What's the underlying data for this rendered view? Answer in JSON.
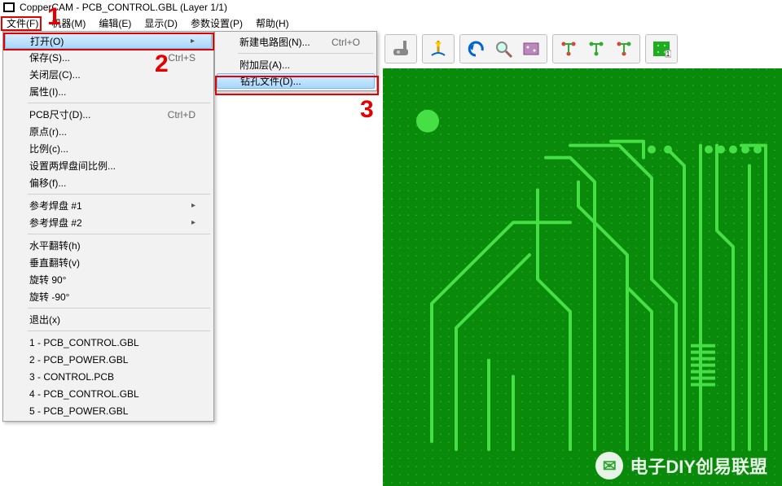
{
  "title": "CopperCAM  -  PCB_CONTROL.GBL   (Layer 1/1)",
  "menubar": [
    "文件(F)",
    "机器(M)",
    "编辑(E)",
    "显示(D)",
    "参数设置(P)",
    "帮助(H)"
  ],
  "annotations": {
    "n1": "1",
    "n2": "2",
    "n3": "3"
  },
  "file_menu": [
    {
      "k": "open",
      "label": "打开(O)",
      "arrow": true,
      "hi": true
    },
    {
      "k": "save",
      "label": "保存(S)...",
      "sc": "Ctrl+S"
    },
    {
      "k": "close",
      "label": "关闭层(C)..."
    },
    {
      "k": "attr",
      "label": "属性(I)..."
    },
    {
      "sep": true
    },
    {
      "k": "dim",
      "label": "PCB尺寸(D)...",
      "sc": "Ctrl+D"
    },
    {
      "k": "origin",
      "label": "原点(r)..."
    },
    {
      "k": "scale",
      "label": "比例(c)..."
    },
    {
      "k": "pads",
      "label": "设置两焊盘间比例..."
    },
    {
      "k": "offset",
      "label": "偏移(f)..."
    },
    {
      "sep": true
    },
    {
      "k": "rp1",
      "label": "参考焊盘 #1",
      "arrow": true
    },
    {
      "k": "rp2",
      "label": "参考焊盘 #2",
      "arrow": true
    },
    {
      "sep": true
    },
    {
      "k": "fliph",
      "label": "水平翻转(h)"
    },
    {
      "k": "flipv",
      "label": "垂直翻转(v)"
    },
    {
      "k": "rot90",
      "label": "旋转 90°"
    },
    {
      "k": "rotn90",
      "label": "旋转 -90°"
    },
    {
      "sep": true
    },
    {
      "k": "exit",
      "label": "退出(x)"
    },
    {
      "sep": true
    },
    {
      "k": "r1",
      "label": "1 - PCB_CONTROL.GBL"
    },
    {
      "k": "r2",
      "label": "2 - PCB_POWER.GBL"
    },
    {
      "k": "r3",
      "label": "3 - CONTROL.PCB"
    },
    {
      "k": "r4",
      "label": "4 - PCB_CONTROL.GBL"
    },
    {
      "k": "r5",
      "label": "5 - PCB_POWER.GBL"
    }
  ],
  "open_submenu": [
    {
      "k": "new",
      "label": "新建电路图(N)...",
      "sc": "Ctrl+O"
    },
    {
      "sep": true
    },
    {
      "k": "addl",
      "label": "附加层(A)..."
    },
    {
      "k": "drill",
      "label": "钻孔文件(D)...",
      "hi": true
    }
  ],
  "watermark": "电子DIY创易联盟"
}
